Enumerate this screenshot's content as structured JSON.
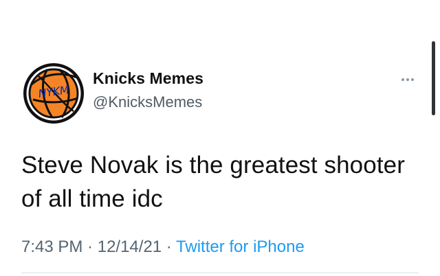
{
  "tweet": {
    "author": {
      "display_name": "Knicks Memes",
      "username": "@KnicksMemes",
      "avatar_text": "NYKM",
      "avatar_icon": "basketball-logo-icon"
    },
    "menu_icon": "more-horizontal-icon",
    "text": "Steve Novak is the greatest shooter\nof all time idc",
    "meta": {
      "time": "7:43 PM",
      "separator_1": " · ",
      "date": "12/14/21",
      "separator_2": " · ",
      "source": "Twitter for iPhone"
    },
    "colors": {
      "source_link": "#1d9bf0",
      "avatar_orange": "#f58426",
      "avatar_blue": "#0a2aa3"
    }
  }
}
